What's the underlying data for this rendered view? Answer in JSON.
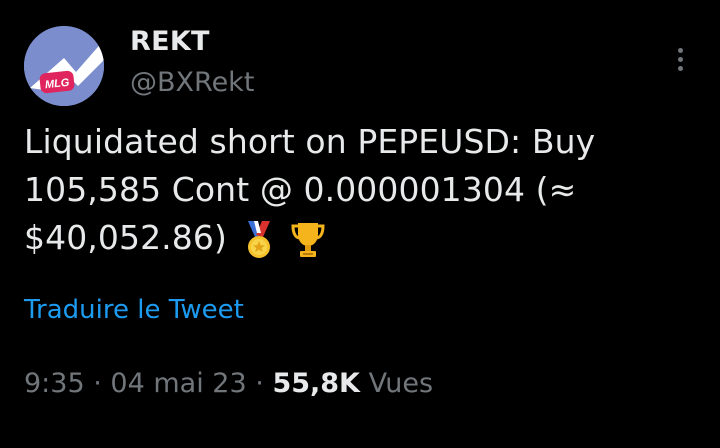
{
  "author": {
    "display_name": "REKT",
    "handle": "@BXRekt",
    "avatar_text": "MLG"
  },
  "tweet": {
    "lines": [
      "Liquidated short on PEPEUSD: Buy",
      "105,585 Cont @ 0.000001304 (≈",
      "$40,052.86)"
    ],
    "emojis": [
      "medal-icon",
      "trophy-icon"
    ],
    "translate_label": "Traduire le Tweet"
  },
  "meta": {
    "time": "9:35",
    "separator": "·",
    "date": "04 mai 23",
    "views_count": "55,8K",
    "views_label": "Vues"
  },
  "colors": {
    "background": "#000000",
    "primary_text": "#e7e9ea",
    "secondary_text": "#71767b",
    "link": "#1d9bf0",
    "avatar_bg": "#7b8dcc",
    "avatar_accent": "#e0245e"
  }
}
